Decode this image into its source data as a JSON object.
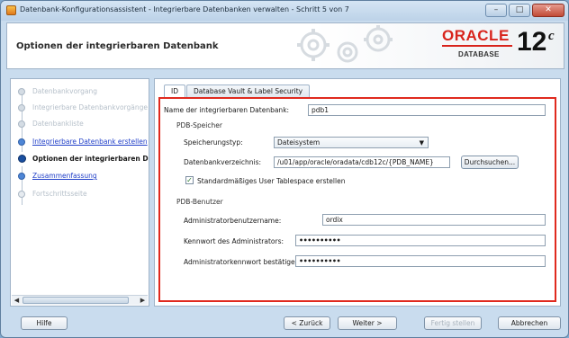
{
  "window": {
    "title": "Datenbank-Konfigurationsassistent - Integrierbare Datenbanken verwalten - Schritt 5 von 7",
    "controls": [
      "–",
      "□",
      "✕"
    ]
  },
  "header": {
    "page_title": "Optionen der integrierbaren Datenbank",
    "logo": {
      "brand": "ORACLE",
      "product": "DATABASE",
      "version": "12",
      "suffix": "c",
      "brand_color": "#d8241c"
    }
  },
  "nav": {
    "items": [
      {
        "label": "Datenbankvorgang",
        "state": "done"
      },
      {
        "label": "Integrierbare Datenbankvorgänge",
        "state": "done"
      },
      {
        "label": "Datenbankliste",
        "state": "done"
      },
      {
        "label": "Integrierbare Datenbank erstellen",
        "state": "link"
      },
      {
        "label": "Optionen der integrierbaren Datenbank",
        "state": "current"
      },
      {
        "label": "Zusammenfassung",
        "state": "link"
      },
      {
        "label": "Fortschrittsseite",
        "state": "future"
      }
    ]
  },
  "tabs": [
    {
      "label": "ID",
      "active": true
    },
    {
      "label": "Database Vault & Label Security",
      "active": false
    }
  ],
  "form": {
    "pdb_name_label": "Name der integrierbaren Datenbank:",
    "pdb_name_value": "pdb1",
    "storage_section": "PDB-Speicher",
    "storage_type_label": "Speicherungstyp:",
    "storage_type_value": "Dateisystem",
    "db_dir_label": "Datenbankverzeichnis:",
    "db_dir_value": "/u01/app/oracle/oradata/cdb12c/{PDB_NAME}",
    "browse_button": "Durchsuchen...",
    "tablespace_checkbox_label": "Standardmäßiges User Tablespace erstellen",
    "tablespace_checked": true,
    "user_section": "PDB-Benutzer",
    "admin_user_label": "Administratorbenutzername:",
    "admin_user_value": "ordix",
    "admin_pw_label": "Kennwort des Administrators:",
    "admin_pw_value": "••••••••••",
    "admin_pw_confirm_label": "Administratorkennwort bestätigen:",
    "admin_pw_confirm_value": "••••••••••"
  },
  "footer": {
    "help": "Hilfe",
    "back": "< Zurück",
    "next": "Weiter >",
    "finish": "Fertig stellen",
    "cancel": "Abbrechen"
  },
  "colors": {
    "highlight_border": "#e02a1e",
    "link": "#1f3ec8"
  }
}
